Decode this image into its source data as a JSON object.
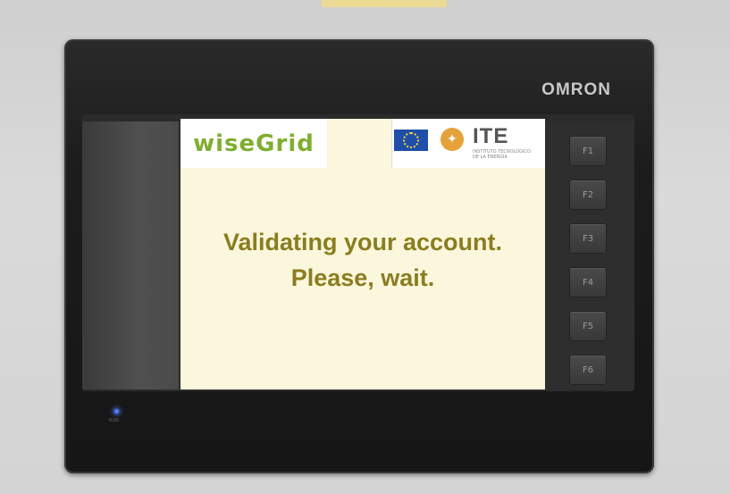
{
  "device": {
    "brand": "OMRON",
    "led_label": "RUN",
    "function_keys": [
      "F1",
      "F2",
      "F3",
      "F4",
      "F5",
      "F6"
    ]
  },
  "screen": {
    "logo_left": "wiseGrid",
    "logo_right_text": "ITE",
    "logo_right_subtext": "INSTITUTO TECNOLÓGICO DE LA ENERGÍA",
    "message_line1": "Validating your account.",
    "message_line2": "Please, wait."
  },
  "colors": {
    "screen_background": "#fbf7dd",
    "message_text": "#8a7d1f",
    "device_body": "#1c1c1c",
    "led": "#4f7bff"
  }
}
